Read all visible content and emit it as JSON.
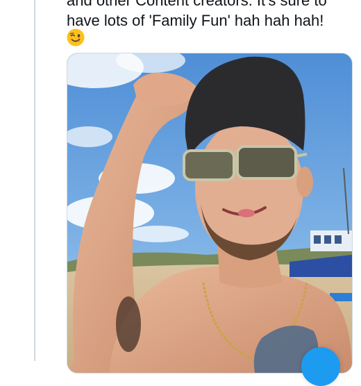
{
  "tweet": {
    "text_line_1": "and other Content creators. It's sure to",
    "text_line_2": "have lots of 'Family Fun' hah hah hah!",
    "emoji": "winking-face-with-tongue",
    "accent_color": "#1d9bf0"
  },
  "media": {
    "kind": "photo"
  }
}
